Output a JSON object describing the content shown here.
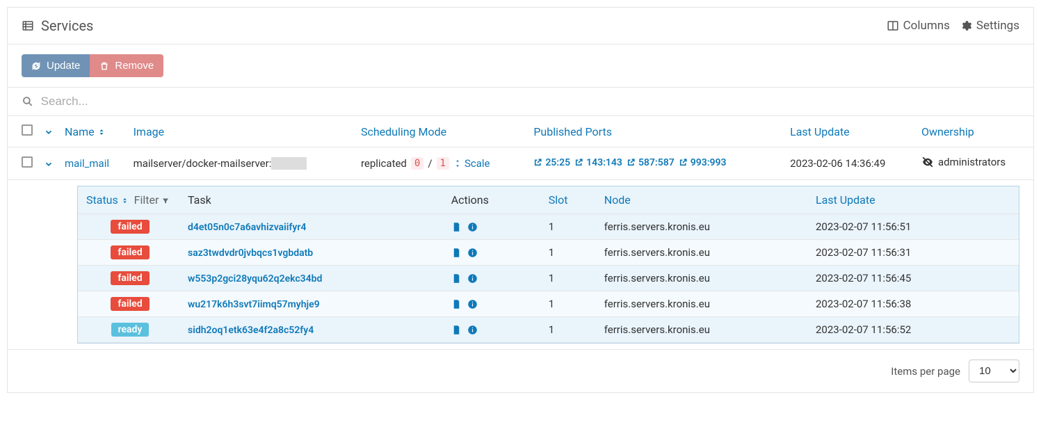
{
  "header": {
    "title": "Services",
    "columns_label": "Columns",
    "settings_label": "Settings"
  },
  "buttons": {
    "update": "Update",
    "remove": "Remove"
  },
  "search": {
    "placeholder": "Search..."
  },
  "table": {
    "headers": {
      "name": "Name",
      "image": "Image",
      "scheduling": "Scheduling Mode",
      "ports": "Published Ports",
      "last_update": "Last Update",
      "ownership": "Ownership"
    }
  },
  "row": {
    "name": "mail_mail",
    "image": "mailserver/docker-mailserver:",
    "scheduling_mode": "replicated",
    "replicas_current": "0",
    "replicas_sep": "/",
    "replicas_target": "1",
    "scale_label": "Scale",
    "ports": [
      "25:25",
      "143:143",
      "587:587",
      "993:993"
    ],
    "last_update": "2023-02-06 14:36:49",
    "ownership": "administrators"
  },
  "subtable": {
    "headers": {
      "status": "Status",
      "filter": "Filter",
      "task": "Task",
      "actions": "Actions",
      "slot": "Slot",
      "node": "Node",
      "last_update": "Last Update"
    },
    "rows": [
      {
        "status": "failed",
        "task": "d4et05n0c7a6avhizvaiifyr4",
        "slot": "1",
        "node": "ferris.servers.kronis.eu",
        "last_update": "2023-02-07 11:56:51"
      },
      {
        "status": "failed",
        "task": "saz3twdvdr0jvbqcs1vgbdatb",
        "slot": "1",
        "node": "ferris.servers.kronis.eu",
        "last_update": "2023-02-07 11:56:31"
      },
      {
        "status": "failed",
        "task": "w553p2gci28yqu62q2ekc34bd",
        "slot": "1",
        "node": "ferris.servers.kronis.eu",
        "last_update": "2023-02-07 11:56:45"
      },
      {
        "status": "failed",
        "task": "wu217k6h3svt7iimq57myhje9",
        "slot": "1",
        "node": "ferris.servers.kronis.eu",
        "last_update": "2023-02-07 11:56:38"
      },
      {
        "status": "ready",
        "task": "sidh2oq1etk63e4f2a8c52fy4",
        "slot": "1",
        "node": "ferris.servers.kronis.eu",
        "last_update": "2023-02-07 11:56:52"
      }
    ]
  },
  "footer": {
    "items_per_page_label": "Items per page",
    "items_per_page_value": "10"
  }
}
